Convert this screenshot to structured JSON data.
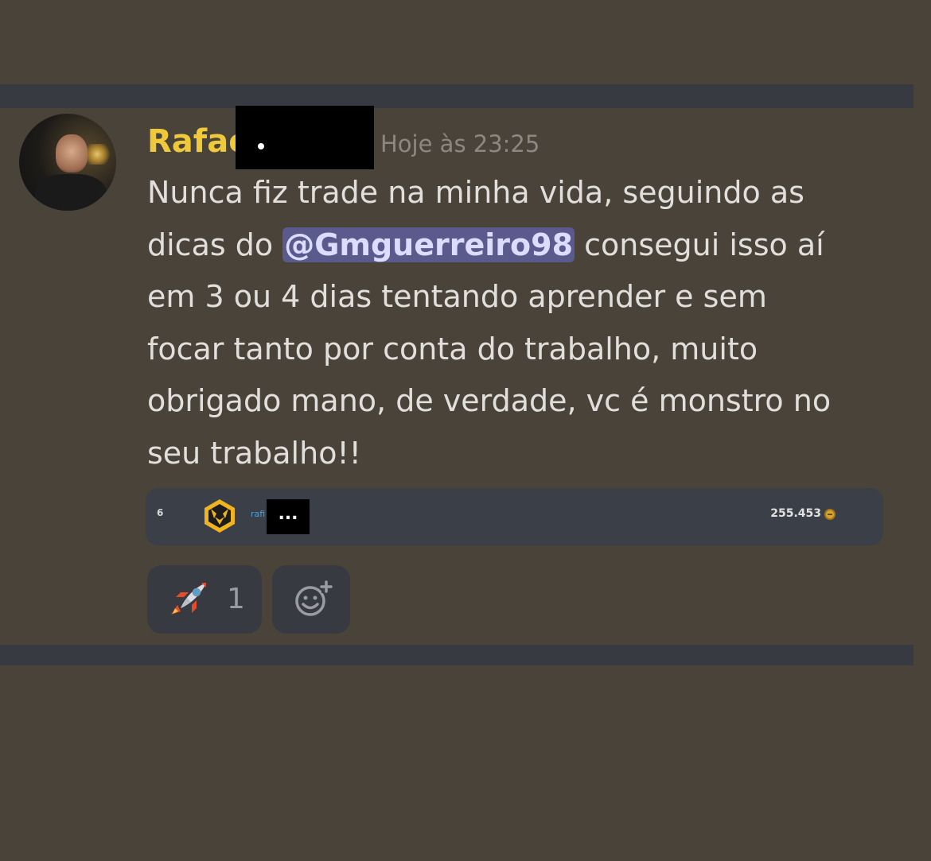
{
  "message": {
    "author": "Rafae",
    "redacted_suffix": ".",
    "timestamp": "Hoje às 23:25",
    "lines": [
      {
        "text": "Nunca fiz trade na minha vida, seguindo as"
      },
      {
        "pre": "dicas do ",
        "mention": "@Gmguerreiro98",
        "post": " consegui isso aí"
      },
      {
        "text": "em 3 ou 4 dias tentando aprender e sem"
      },
      {
        "text": "focar tanto por conta do trabalho, muito"
      },
      {
        "text": "obrigado mano, de verdade, vc é monstro no"
      },
      {
        "text": "seu trabalho!!"
      }
    ]
  },
  "embed": {
    "rank": "6",
    "name_fragment": "rafi",
    "redacted_label": "...",
    "score": "255.453",
    "icons": [
      "wolf-badge-icon",
      "coin-icon"
    ]
  },
  "reactions": [
    {
      "emoji": "rocket-icon",
      "count": "1"
    }
  ],
  "add_reaction_icon": "add-emoji-icon",
  "colors": {
    "background": "#4a433a",
    "divider": "#383a41",
    "username": "#f0c93a",
    "timestamp": "#8b8882",
    "text": "#e1dfdb",
    "mention_bg": "#5a5a8c",
    "embed_bg": "#3b3f48",
    "reaction_bg": "#383a42"
  }
}
